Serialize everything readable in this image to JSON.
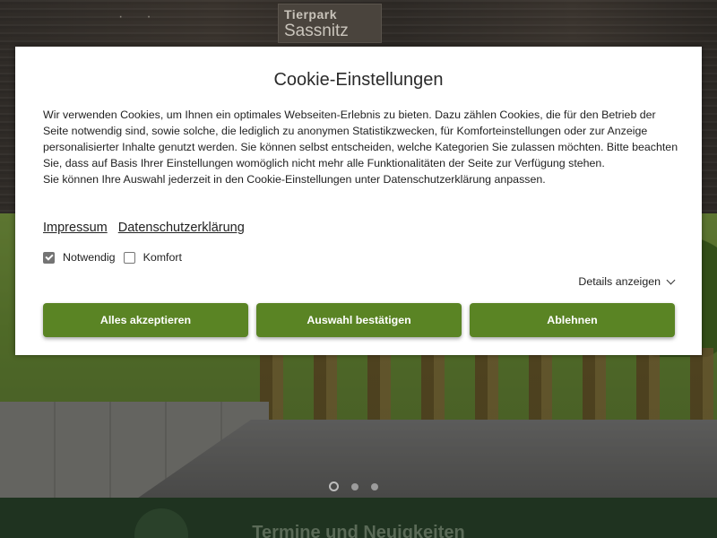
{
  "site": {
    "logo_line1": "Tierpark",
    "logo_line2": "Sassnitz",
    "news_heading": "Termine und Neuigkeiten"
  },
  "cookie_modal": {
    "title": "Cookie-Einstellungen",
    "paragraph1": "Wir verwenden Cookies, um Ihnen ein optimales Webseiten-Erlebnis zu bieten. Dazu zählen Cookies, die für den Betrieb der Seite notwendig sind, sowie solche, die lediglich zu anonymen Statistikzwecken, für Komforteinstellungen oder zur Anzeige personalisierter Inhalte genutzt werden. Sie können selbst entscheiden, welche Kategorien Sie zulassen möchten. Bitte beachten Sie, dass auf Basis Ihrer Einstellungen womöglich nicht mehr alle Funktionalitäten der Seite zur Verfügung stehen.",
    "paragraph2": "Sie können Ihre Auswahl jederzeit in den Cookie-Einstellungen unter Datenschutzerklärung anpassen.",
    "links": {
      "imprint": "Impressum",
      "privacy": "Datenschutzerklärung"
    },
    "options": [
      {
        "label": "Notwendig",
        "checked": true
      },
      {
        "label": "Komfort",
        "checked": false
      }
    ],
    "details_label": "Details anzeigen",
    "buttons": {
      "accept_all": "Alles akzeptieren",
      "confirm_selection": "Auswahl bestätigen",
      "decline": "Ablehnen"
    }
  },
  "slider": {
    "slide_count": 3,
    "active_slide": 1
  },
  "colors": {
    "button_green": "#5a8424",
    "checkbox_checked": "#747474",
    "news_band": "#1f3320"
  }
}
